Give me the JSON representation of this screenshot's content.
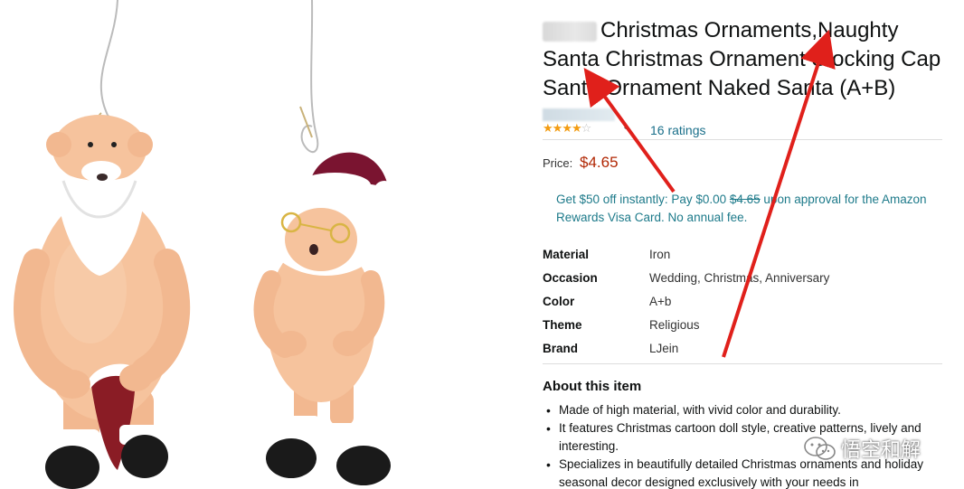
{
  "product": {
    "title": "Christmas Ornaments,Naughty Santa Christmas Ornament Stocking Cap Santa Ornament Naked Santa (A+B)",
    "rating": {
      "stars_filled": 4,
      "stars_total": 5,
      "count_label": "16 ratings"
    },
    "price": {
      "label": "Price:",
      "value": "$4.65"
    },
    "promo": {
      "text_before": "Get $50 off instantly: Pay $0.00 ",
      "struck_price": "$4.65",
      "text_after": " upon approval for the Amazon Rewards Visa Card. No annual fee."
    },
    "specs": [
      {
        "key": "Material",
        "value": "Iron"
      },
      {
        "key": "Occasion",
        "value": "Wedding, Christmas, Anniversary"
      },
      {
        "key": "Color",
        "value": "A+b"
      },
      {
        "key": "Theme",
        "value": "Religious"
      },
      {
        "key": "Brand",
        "value": "LJein"
      }
    ],
    "about": {
      "title": "About this item",
      "bullets": [
        "Made of high material, with vivid color and durability.",
        "It features Christmas cartoon doll style, creative patterns, lively and interesting.",
        "Specializes in beautifully detailed Christmas ornaments and holiday seasonal decor designed exclusively with your needs in"
      ]
    }
  },
  "colors": {
    "price": "#b12704",
    "link": "#1a6f8a",
    "star": "#f39c12",
    "annotation_arrow": "#e0201b"
  },
  "watermark": {
    "icon": "wechat-icon",
    "text": "悟空和解"
  }
}
